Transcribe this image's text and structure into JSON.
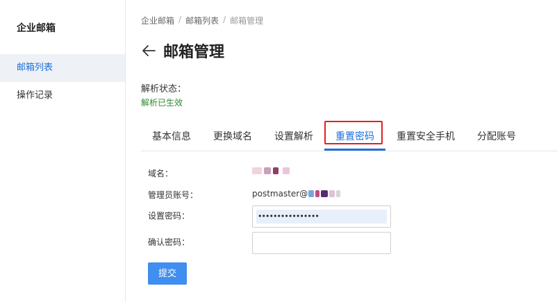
{
  "sidebar": {
    "title": "企业邮箱",
    "items": [
      {
        "label": "邮箱列表",
        "active": true
      },
      {
        "label": "操作记录",
        "active": false
      }
    ]
  },
  "breadcrumb": [
    "企业邮箱",
    "邮箱列表",
    "邮箱管理"
  ],
  "header": {
    "back_icon": "arrow-left-icon",
    "title": "邮箱管理"
  },
  "status": {
    "label": "解析状态：",
    "value": "解析已生效",
    "value_color": "#2e8b2e"
  },
  "tabs": [
    {
      "label": "基本信息",
      "active": false
    },
    {
      "label": "更换域名",
      "active": false
    },
    {
      "label": "设置解析",
      "active": false
    },
    {
      "label": "重置密码",
      "active": true
    },
    {
      "label": "重置安全手机",
      "active": false
    },
    {
      "label": "分配账号",
      "active": false
    }
  ],
  "form": {
    "domain_label": "域名：",
    "admin_label": "管理员账号：",
    "admin_value_prefix": "postmaster@",
    "password_label": "设置密码：",
    "password_value": "••••••••••••••••",
    "confirm_label": "确认密码：",
    "confirm_value": "",
    "submit_label": "提交"
  },
  "colors": {
    "accent": "#1e6fd9",
    "button": "#3f8ef0",
    "highlight_border": "#e02020",
    "success": "#2e8b2e"
  }
}
